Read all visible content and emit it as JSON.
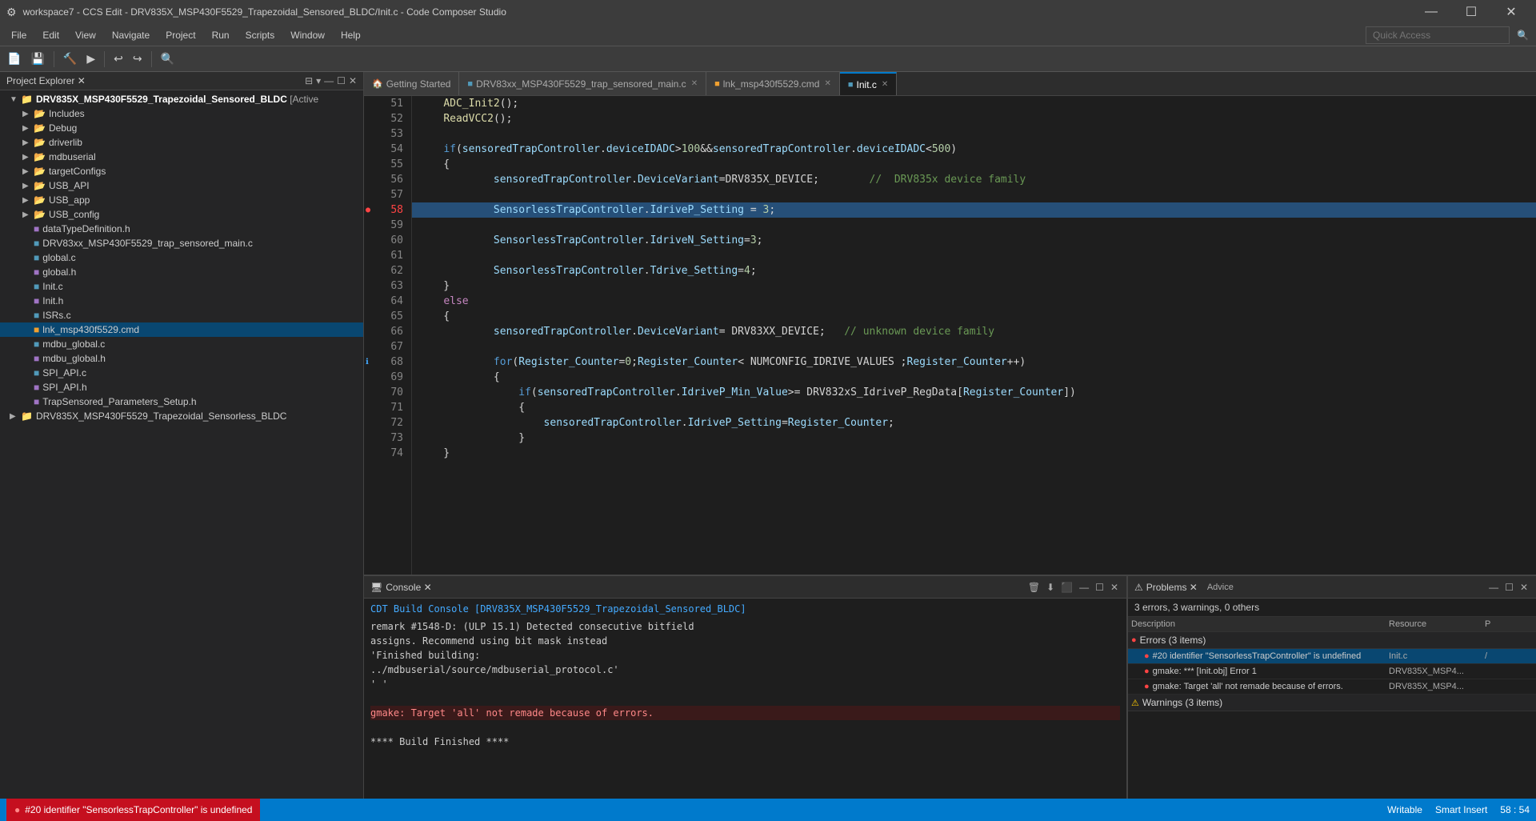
{
  "titleBar": {
    "icon": "⚙",
    "title": "workspace7 - CCS Edit - DRV835X_MSP430F5529_Trapezoidal_Sensored_BLDC/Init.c - Code Composer Studio",
    "minimize": "—",
    "maximize": "☐",
    "close": "✕"
  },
  "menuBar": {
    "items": [
      "File",
      "Edit",
      "View",
      "Navigate",
      "Project",
      "Run",
      "Scripts",
      "Window",
      "Help"
    ],
    "quickAccessPlaceholder": "Quick Access"
  },
  "projectExplorer": {
    "title": "Project Explorer",
    "activeProject": "DRV835X_MSP430F5529_Trapezoidal_Sensored_BLDC",
    "activeLabel": "[Active",
    "tree": [
      {
        "id": "root1",
        "label": "DRV835X_MSP430F5529_Trapezoidal_Sensored_BLDC [Active",
        "type": "project",
        "depth": 0,
        "expanded": true
      },
      {
        "id": "includes",
        "label": "Includes",
        "type": "folder",
        "depth": 1,
        "expanded": false
      },
      {
        "id": "debug",
        "label": "Debug",
        "type": "folder",
        "depth": 1,
        "expanded": false
      },
      {
        "id": "driverlib",
        "label": "driverlib",
        "type": "folder",
        "depth": 1,
        "expanded": false
      },
      {
        "id": "mdbuserial",
        "label": "mdbuserial",
        "type": "folder",
        "depth": 1,
        "expanded": false
      },
      {
        "id": "targetconfigs",
        "label": "targetConfigs",
        "type": "folder",
        "depth": 1,
        "expanded": false
      },
      {
        "id": "usbapi",
        "label": "USB_API",
        "type": "folder",
        "depth": 1,
        "expanded": false
      },
      {
        "id": "usbapp",
        "label": "USB_app",
        "type": "folder",
        "depth": 1,
        "expanded": false
      },
      {
        "id": "usbconfig",
        "label": "USB_config",
        "type": "folder",
        "depth": 1,
        "expanded": false
      },
      {
        "id": "dataTypeDefinition",
        "label": "dataTypeDefinition.h",
        "type": "h",
        "depth": 1
      },
      {
        "id": "drv83main",
        "label": "DRV83xx_MSP430F5529_trap_sensored_main.c",
        "type": "c",
        "depth": 1
      },
      {
        "id": "globalc",
        "label": "global.c",
        "type": "c",
        "depth": 1
      },
      {
        "id": "globalh",
        "label": "global.h",
        "type": "h",
        "depth": 1
      },
      {
        "id": "initc",
        "label": "Init.c",
        "type": "c",
        "depth": 1
      },
      {
        "id": "inith",
        "label": "Init.h",
        "type": "h",
        "depth": 1
      },
      {
        "id": "isrsc",
        "label": "ISRs.c",
        "type": "c",
        "depth": 1
      },
      {
        "id": "lnkcmd",
        "label": "lnk_msp430f5529.cmd",
        "type": "cmd",
        "depth": 1,
        "selected": true
      },
      {
        "id": "mdbuglobalc",
        "label": "mdbu_global.c",
        "type": "c",
        "depth": 1
      },
      {
        "id": "mdbuglobalh",
        "label": "mdbu_global.h",
        "type": "h",
        "depth": 1
      },
      {
        "id": "spiapicc",
        "label": "SPI_API.c",
        "type": "c",
        "depth": 1
      },
      {
        "id": "spiaph",
        "label": "SPI_API.h",
        "type": "h",
        "depth": 1
      },
      {
        "id": "trapsetup",
        "label": "TrapSensored_Parameters_Setup.h",
        "type": "h",
        "depth": 1
      },
      {
        "id": "sensorlessproject",
        "label": "DRV835X_MSP430F5529_Trapezoidal_Sensorless_BLDC",
        "type": "project",
        "depth": 0,
        "expanded": false
      }
    ]
  },
  "tabs": [
    {
      "id": "tab-getting-started",
      "label": "Getting Started",
      "active": false,
      "closeable": false
    },
    {
      "id": "tab-main",
      "label": "DRV83xx_MSP430F5529_trap_sensored_main.c",
      "active": false,
      "closeable": true
    },
    {
      "id": "tab-lnk",
      "label": "lnk_msp430f5529.cmd",
      "active": false,
      "closeable": true
    },
    {
      "id": "tab-init",
      "label": "Init.c",
      "active": true,
      "closeable": true
    }
  ],
  "codeLines": [
    {
      "num": 51,
      "content": "    ADC_Init2();",
      "hasError": false,
      "hasInfo": false,
      "selected": false
    },
    {
      "num": 52,
      "content": "    ReadVCC2();",
      "hasError": false,
      "hasInfo": false,
      "selected": false
    },
    {
      "num": 53,
      "content": "",
      "hasError": false,
      "hasInfo": false,
      "selected": false
    },
    {
      "num": 54,
      "content": "    if (sensoredTrapController.deviceIDADC > 100 && sensoredTrapController.deviceIDADC < 500 )",
      "hasError": false,
      "hasInfo": false,
      "selected": false
    },
    {
      "num": 55,
      "content": "    {",
      "hasError": false,
      "hasInfo": false,
      "selected": false
    },
    {
      "num": 56,
      "content": "            sensoredTrapController.DeviceVariant = DRV835X_DEVICE;        //  DRV835x device family",
      "hasError": false,
      "hasInfo": false,
      "selected": false
    },
    {
      "num": 57,
      "content": "",
      "hasError": false,
      "hasInfo": false,
      "selected": false
    },
    {
      "num": 58,
      "content": "            SensorlessTrapController.IdriveP_Setting = 3;",
      "hasError": true,
      "hasInfo": false,
      "selected": true
    },
    {
      "num": 59,
      "content": "",
      "hasError": false,
      "hasInfo": false,
      "selected": false
    },
    {
      "num": 60,
      "content": "            SensorlessTrapController.IdriveN_Setting = 3;",
      "hasError": false,
      "hasInfo": false,
      "selected": false
    },
    {
      "num": 61,
      "content": "",
      "hasError": false,
      "hasInfo": false,
      "selected": false
    },
    {
      "num": 62,
      "content": "            SensorlessTrapController.Tdrive_Setting = 4;",
      "hasError": false,
      "hasInfo": false,
      "selected": false
    },
    {
      "num": 63,
      "content": "    }",
      "hasError": false,
      "hasInfo": false,
      "selected": false
    },
    {
      "num": 64,
      "content": "    else",
      "hasError": false,
      "hasInfo": false,
      "selected": false
    },
    {
      "num": 65,
      "content": "    {",
      "hasError": false,
      "hasInfo": false,
      "selected": false
    },
    {
      "num": 66,
      "content": "            sensoredTrapController.DeviceVariant = DRV83XX_DEVICE;   // unknown device family",
      "hasError": false,
      "hasInfo": false,
      "selected": false
    },
    {
      "num": 67,
      "content": "",
      "hasError": false,
      "hasInfo": false,
      "selected": false
    },
    {
      "num": 68,
      "content": "            for(Register_Counter = 0; Register_Counter < NUMCONFIG_IDRIVE_VALUES ; Register_Counter++)",
      "hasError": false,
      "hasInfo": true,
      "selected": false
    },
    {
      "num": 69,
      "content": "            {",
      "hasError": false,
      "hasInfo": false,
      "selected": false
    },
    {
      "num": 70,
      "content": "                if(sensoredTrapController.IdriveP_Min_Value >= DRV832xS_IdriveP_RegData[Register_Counter])",
      "hasError": false,
      "hasInfo": false,
      "selected": false
    },
    {
      "num": 71,
      "content": "                {",
      "hasError": false,
      "hasInfo": false,
      "selected": false
    },
    {
      "num": 72,
      "content": "                    sensoredTrapController.IdriveP_Setting = Register_Counter;",
      "hasError": false,
      "hasInfo": false,
      "selected": false
    },
    {
      "num": 73,
      "content": "                }",
      "hasError": false,
      "hasInfo": false,
      "selected": false
    },
    {
      "num": 74,
      "content": "    }",
      "hasError": false,
      "hasInfo": false,
      "selected": false
    }
  ],
  "console": {
    "title": "Console",
    "buildTitle": "CDT Build Console [DRV835X_MSP430F5529_Trapezoidal_Sensored_BLDC]",
    "lines": [
      "remark #1548-D: (ULP 15.1) Detected consecutive bitfield",
      "assigns. Recommend using bit mask instead",
      "'Finished building:",
      "../mdbuserial/source/mdbuserial_protocol.c'",
      "' '",
      "",
      "gmake: Target 'all' not remade because of errors.",
      "",
      "**** Build Finished ****"
    ],
    "errorLine": "gmake: Target 'all' not remade because of errors."
  },
  "problems": {
    "title": "Problems",
    "adviceTitle": "Advice",
    "summary": "3 errors, 3 warnings, 0 others",
    "columns": {
      "description": "Description",
      "resource": "Resource",
      "path": "P"
    },
    "errors": {
      "label": "Errors (3 items)",
      "items": [
        {
          "id": "err1",
          "desc": "#20 identifier \"SensorlessTrapController\" is undefined",
          "resource": "Init.c",
          "path": "/",
          "selected": true
        },
        {
          "id": "err2",
          "desc": "gmake: *** [Init.obj] Error 1",
          "resource": "DRV835X_MSP4...",
          "path": ""
        },
        {
          "id": "err3",
          "desc": "gmake: Target 'all' not remade because of errors.",
          "resource": "DRV835X_MSP4...",
          "path": ""
        }
      ]
    },
    "warnings": {
      "label": "Warnings (3 items)",
      "expanded": false
    }
  },
  "statusBar": {
    "errorMessage": "#20 identifier \"SensorlessTrapController\" is undefined",
    "writeMode": "Writable",
    "insertMode": "Smart Insert",
    "position": "58 : 54"
  }
}
